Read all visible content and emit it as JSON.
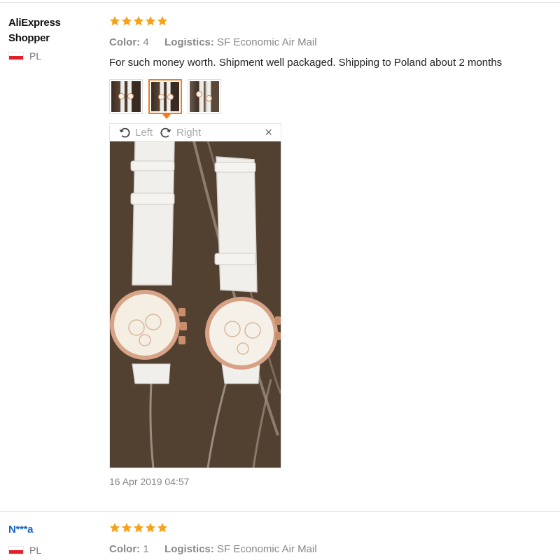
{
  "reviews": [
    {
      "user": "AliExpress Shopper",
      "country": "PL",
      "rating": 5,
      "color_label": "Color:",
      "color_value": "4",
      "logistics_label": "Logistics:",
      "logistics_value": "SF Economic Air Mail",
      "text": "For such money worth. Shipment well packaged. Shipping to Poland about 2 months",
      "thumbnails": 3,
      "active_thumbnail": 1,
      "viewer": {
        "left_label": "Left",
        "right_label": "Right",
        "close_label": "×"
      },
      "timestamp": "16 Apr 2019 04:57"
    },
    {
      "user": "N***a",
      "country": "PL",
      "rating": 5,
      "color_label": "Color:",
      "color_value": "1",
      "logistics_label": "Logistics:",
      "logistics_value": "SF Economic Air Mail"
    }
  ],
  "colors": {
    "star": "#f7a11a",
    "accent": "#f07c1e",
    "link": "#1a66c8"
  },
  "icons": {
    "star": "star-icon",
    "rotate_left": "rotate-left-icon",
    "rotate_right": "rotate-right-icon",
    "close": "close-icon",
    "flag": "poland-flag-icon"
  }
}
